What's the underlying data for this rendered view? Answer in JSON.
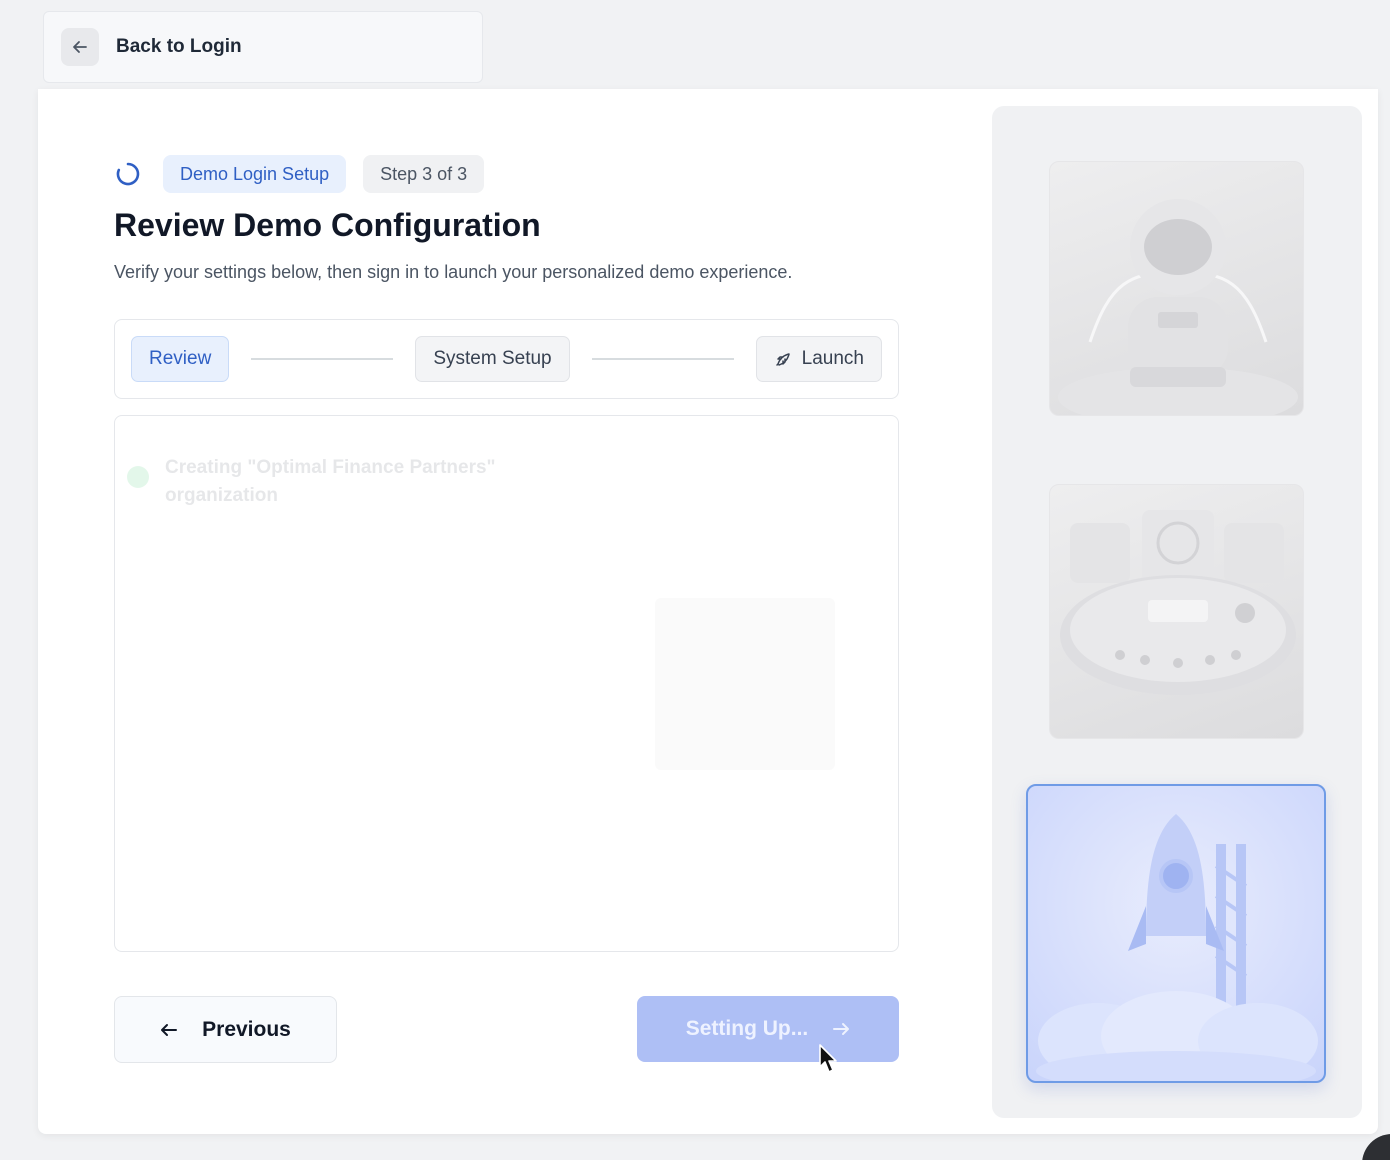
{
  "top_bar": {
    "back_label": "Back to Login"
  },
  "header": {
    "badge_setup": "Demo Login Setup",
    "badge_step": "Step 3 of 3",
    "title": "Review Demo Configuration",
    "subtitle": "Verify your settings below, then sign in to launch your personalized demo experience."
  },
  "stepper": {
    "steps": [
      {
        "label": "Review",
        "state": "active"
      },
      {
        "label": "System Setup",
        "state": "idle"
      },
      {
        "label": "Launch",
        "state": "idle",
        "icon": "rocket-icon"
      }
    ]
  },
  "progress_log": {
    "items": [
      {
        "text": "Creating \"Optimal Finance Partners\" organization",
        "status": "done"
      }
    ]
  },
  "footer": {
    "previous_label": "Previous",
    "submit_label": "Setting Up..."
  },
  "illustrations": [
    {
      "name": "astronaut-illustration",
      "selected": false
    },
    {
      "name": "control-panel-illustration",
      "selected": false
    },
    {
      "name": "rocket-launch-illustration",
      "selected": true
    }
  ],
  "colors": {
    "accent": "#2f5fc4",
    "accent_soft": "#e8f0fd",
    "button_disabled": "#aebff5",
    "selection_border": "#6f9be6"
  }
}
